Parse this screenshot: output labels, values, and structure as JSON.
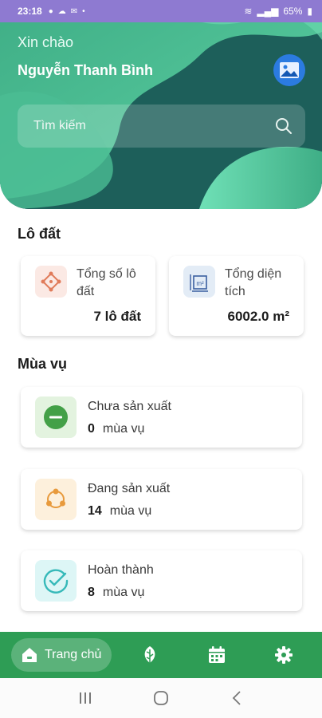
{
  "status_bar": {
    "time": "23:18",
    "battery": "65%"
  },
  "header": {
    "greeting": "Xin chào",
    "username": "Nguyễn Thanh Bình",
    "avatar_icon": "image-icon",
    "search": {
      "placeholder": "Tìm kiếm",
      "icon": "search-icon"
    }
  },
  "plots": {
    "title": "Lô đất",
    "cards": [
      {
        "label": "Tổng số lô đất",
        "value": "7 lô đất",
        "icon": "map-plot-icon",
        "icon_bg": "#fbe9e4",
        "icon_color": "#e07b5a"
      },
      {
        "label": "Tổng diện tích",
        "value": "6002.0 m²",
        "icon": "area-square-meter-icon",
        "icon_bg": "#e3ecf6",
        "icon_color": "#3a5fa0"
      }
    ]
  },
  "seasons": {
    "title": "Mùa vụ",
    "items": [
      {
        "label": "Chưa sản xuất",
        "count": "0",
        "unit": "mùa vụ",
        "icon": "minus-circle-icon",
        "icon_bg": "#e3f3df",
        "icon_color": "#43a047"
      },
      {
        "label": "Đang sản xuất",
        "count": "14",
        "unit": "mùa vụ",
        "icon": "cycle-nodes-icon",
        "icon_bg": "#fdf0dc",
        "icon_color": "#e89a3c"
      },
      {
        "label": "Hoàn thành",
        "count": "8",
        "unit": "mùa vụ",
        "icon": "check-circle-icon",
        "icon_bg": "#ddf6f6",
        "icon_color": "#36b9b9"
      }
    ]
  },
  "bottom_nav": {
    "home_label": "Trang chủ",
    "items": [
      "home-icon",
      "leaf-icon",
      "calendar-icon",
      "settings-gear-icon"
    ]
  },
  "colors": {
    "header_dark": "#1f6f68",
    "header_light": "#4fc39a",
    "nav_green": "#2e9d55",
    "status_bar": "#8e7ad1"
  }
}
